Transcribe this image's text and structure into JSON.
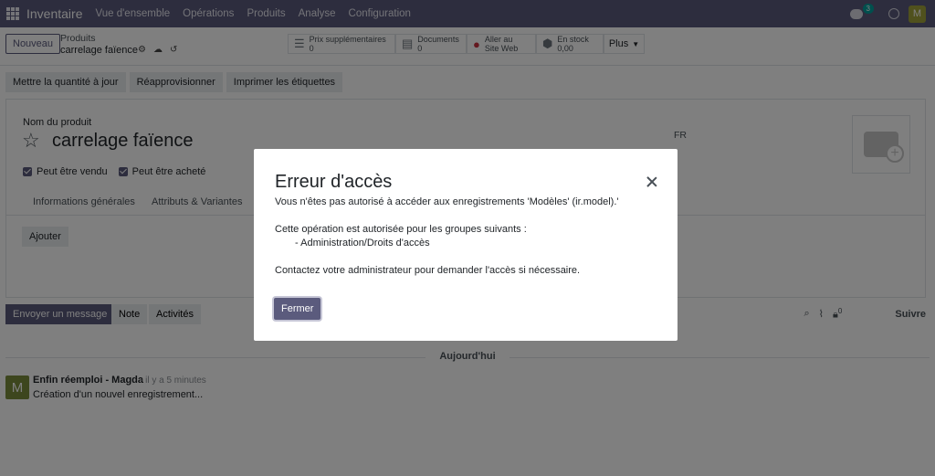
{
  "navbar": {
    "brand": "Inventaire",
    "menu": [
      "Vue d'ensemble",
      "Opérations",
      "Produits",
      "Analyse",
      "Configuration"
    ],
    "chat_badge": "3",
    "user_initial": "M"
  },
  "control_panel": {
    "new_button": "Nouveau",
    "breadcrumb_parent": "Produits",
    "breadcrumb_current": "carrelage faïence",
    "smart_buttons": [
      {
        "icon": "list-icon",
        "line1": "Prix supplémentaires",
        "line2": "0"
      },
      {
        "icon": "document-icon",
        "line1": "Documents",
        "line2": "0"
      },
      {
        "icon": "globe-icon",
        "line1": "Aller au",
        "line2": "Site Web"
      },
      {
        "icon": "cubes-icon",
        "line1": "En stock",
        "line2": "0,00"
      }
    ],
    "more": "Plus"
  },
  "actions": [
    "Mettre la quantité à jour",
    "Réapprovisionner",
    "Imprimer les étiquettes"
  ],
  "form": {
    "name_label": "Nom du produit",
    "product_name": "carrelage faïence",
    "lang": "FR",
    "can_be_sold": "Peut être vendu",
    "can_be_purchased": "Peut être acheté",
    "tabs": [
      "Informations générales",
      "Attributs & Variantes"
    ],
    "add_button": "Ajouter"
  },
  "chatter": {
    "send_message": "Envoyer un message",
    "note": "Note",
    "activities": "Activités",
    "follower_count": "0",
    "follow": "Suivre",
    "day_separator": "Aujourd'hui",
    "message": {
      "avatar_initial": "M",
      "author": "Enfin réemploi - Magda",
      "date": "- il y a 5 minutes",
      "body": "Création d'un nouvel enregistrement..."
    }
  },
  "modal": {
    "title": "Erreur d'accès",
    "line1": "Vous n'êtes pas autorisé à accéder aux enregistrements 'Modèles' (ir.model).'",
    "line2": "Cette opération est autorisée pour les groupes suivants :",
    "line3": "- Administration/Droits d'accès",
    "line4": "Contactez votre administrateur pour demander l'accès si nécessaire.",
    "close_button": "Fermer"
  },
  "colors": {
    "brand": "#5b5b7d",
    "badge": "#00a09d",
    "avatar": "#a0a33a"
  }
}
